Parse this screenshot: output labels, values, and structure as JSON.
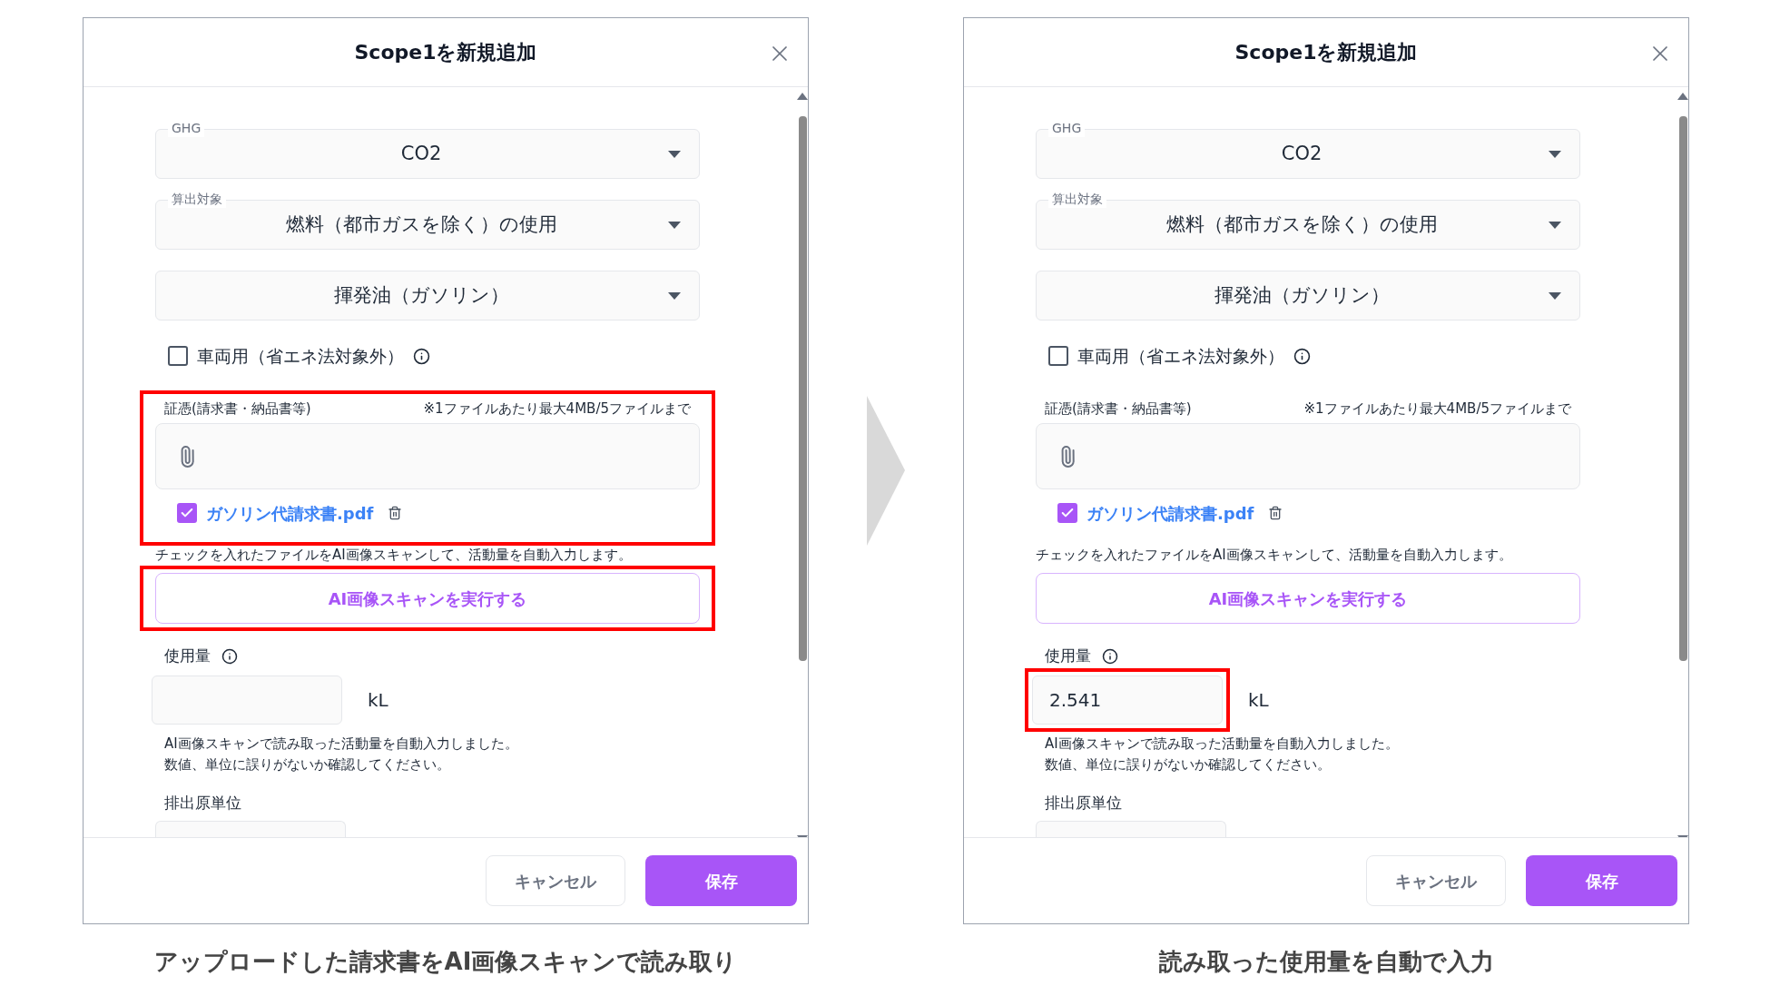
{
  "panels": [
    {
      "dialog": {
        "title": "Scope1を新規追加"
      },
      "selects": [
        {
          "label": "GHG",
          "value": "CO2"
        },
        {
          "label": "算出対象",
          "value": "燃料（都市ガスを除く）の使用"
        },
        {
          "value": "揮発油（ガソリン）"
        }
      ],
      "vehicle": {
        "label": "車両用（省エネ法対象外）",
        "checked": false
      },
      "evidence": {
        "label": "証憑(請求書・納品書等)",
        "note": "※1ファイルあたり最大4MB/5ファイルまで",
        "highlighted": true,
        "files": [
          {
            "name": "ガソリン代請求書.pdf",
            "checked": true
          }
        ]
      },
      "scan_hint": "チェックを入れたファイルをAI画像スキャンして、活動量を自動入力します。",
      "scan_button": {
        "label": "AI画像スキャンを実行する",
        "highlighted": true
      },
      "usage": {
        "label": "使用量",
        "unit": "kL",
        "highlighted": false
      },
      "usage_note": [
        "AI画像スキャンで読み取った活動量を自動入力しました。",
        "数値、単位に誤りがないか確認してください。"
      ],
      "emission_unit_label": "排出原単位",
      "buttons": {
        "cancel": "キャンセル",
        "save": "保存"
      },
      "caption": "アップロードした請求書をAI画像スキャンで読み取り"
    },
    {
      "dialog": {
        "title": "Scope1を新規追加"
      },
      "selects": [
        {
          "label": "GHG",
          "value": "CO2"
        },
        {
          "label": "算出対象",
          "value": "燃料（都市ガスを除く）の使用"
        },
        {
          "value": "揮発油（ガソリン）"
        }
      ],
      "vehicle": {
        "label": "車両用（省エネ法対象外）",
        "checked": false
      },
      "evidence": {
        "label": "証憑(請求書・納品書等)",
        "note": "※1ファイルあたり最大4MB/5ファイルまで",
        "highlighted": false,
        "files": [
          {
            "name": "ガソリン代請求書.pdf",
            "checked": true
          }
        ]
      },
      "scan_hint": "チェックを入れたファイルをAI画像スキャンして、活動量を自動入力します。",
      "scan_button": {
        "label": "AI画像スキャンを実行する",
        "highlighted": false
      },
      "usage": {
        "label": "使用量",
        "value": "2.541",
        "unit": "kL",
        "highlighted": true
      },
      "usage_note": [
        "AI画像スキャンで読み取った活動量を自動入力しました。",
        "数値、単位に誤りがないか確認してください。"
      ],
      "emission_unit_label": "排出原単位",
      "buttons": {
        "cancel": "キャンセル",
        "save": "保存"
      },
      "caption": "読み取った使用量を自動で入力"
    }
  ]
}
